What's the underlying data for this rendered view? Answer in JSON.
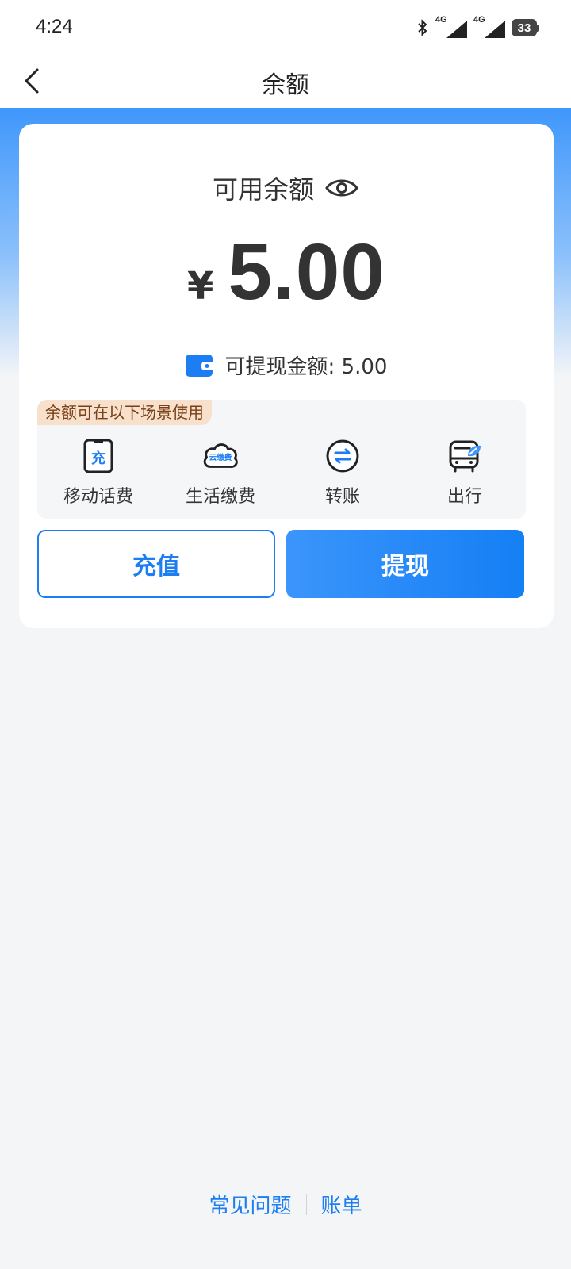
{
  "status_bar": {
    "time": "4:24",
    "network_1": "4G",
    "network_2": "4G",
    "battery": "33"
  },
  "nav": {
    "title": "余额",
    "back_icon": "chevron-left-icon"
  },
  "balance": {
    "label": "可用余额",
    "eye_icon": "eye-icon",
    "currency": "¥",
    "amount": "5.00",
    "withdrawable_label": "可提现金额: 5.00",
    "wallet_icon": "wallet-icon"
  },
  "scenes": {
    "tag": "余额可在以下场景使用",
    "items": [
      {
        "label": "移动话费",
        "icon": "phone-recharge-icon",
        "icon_text": "充"
      },
      {
        "label": "生活缴费",
        "icon": "cloud-pay-icon",
        "icon_text": "云缴费"
      },
      {
        "label": "转账",
        "icon": "transfer-icon"
      },
      {
        "label": "出行",
        "icon": "bus-icon"
      }
    ]
  },
  "actions": {
    "recharge": "充值",
    "withdraw": "提现"
  },
  "footer": {
    "faq": "常见问题",
    "bill": "账单"
  },
  "colors": {
    "accent": "#1c7ef2",
    "hero_gradient_top": "#3f97fb",
    "tag_bg": "#f7e0cc",
    "tag_text": "#7a3f16"
  }
}
